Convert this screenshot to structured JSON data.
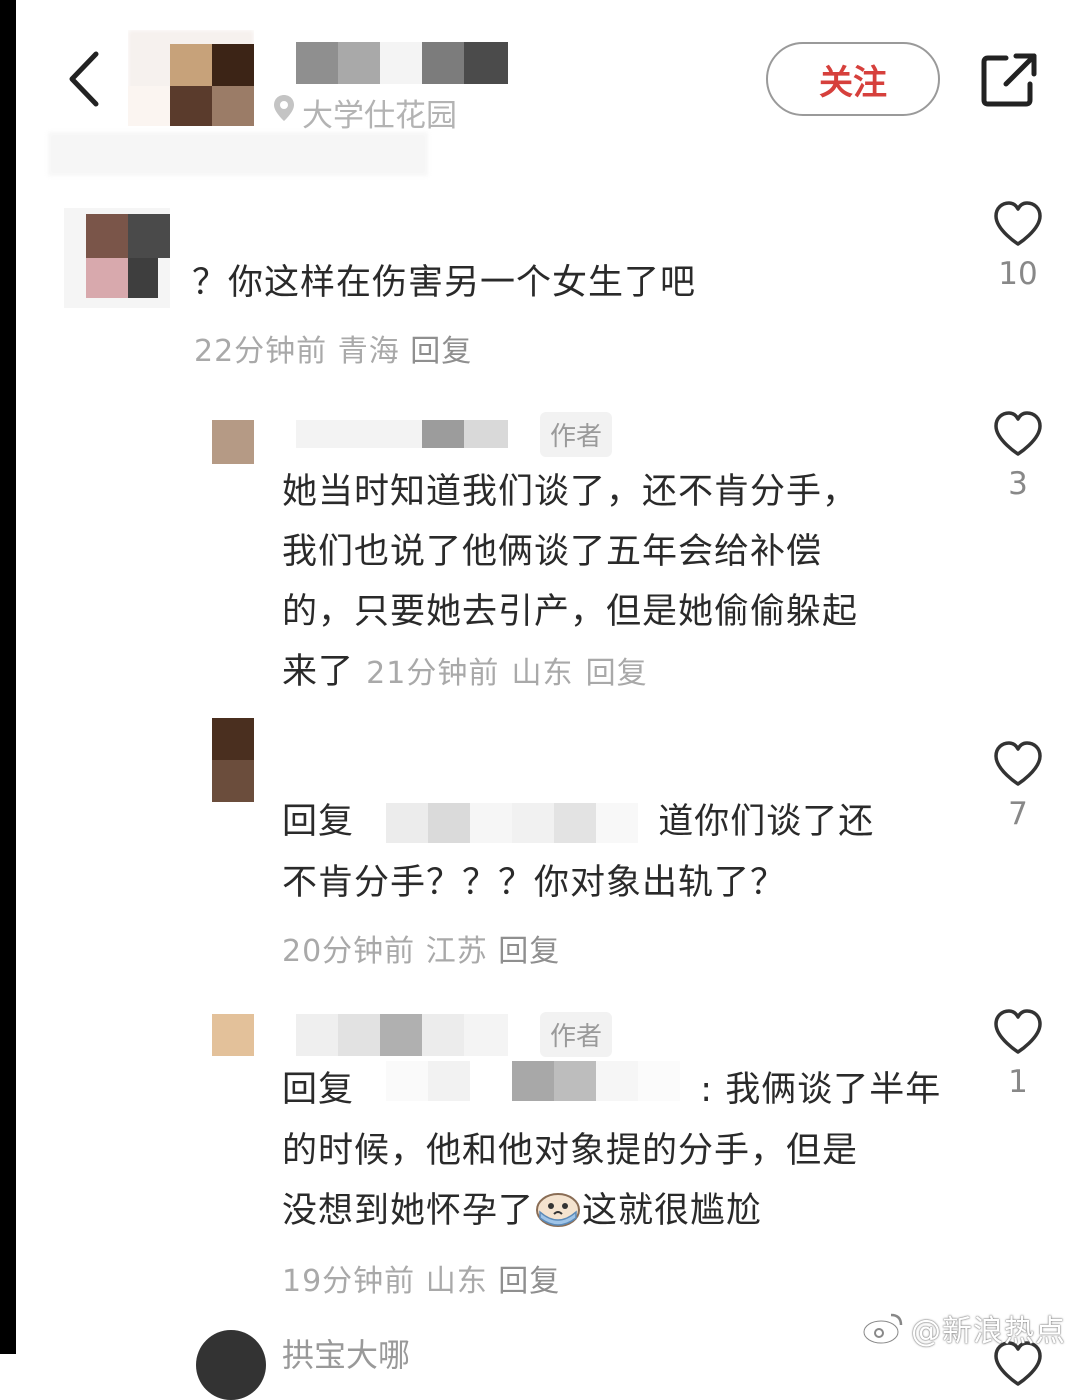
{
  "header": {
    "location": "大学仕花园",
    "follow_label": "关注"
  },
  "comments": [
    {
      "text": "？你这样在伤害另一个女生了吧",
      "time": "22分钟前",
      "region": "青海",
      "reply_label": "回复",
      "likes": "10"
    },
    {
      "author_tag": "作者",
      "lines": [
        "她当时知道我们谈了，还不肯分手，",
        "我们也说了他俩谈了五年会给补偿",
        "的，只要她去引产，但是她偷偷躲起"
      ],
      "last_line": "来了",
      "time": "21分钟前",
      "region": "山东",
      "reply_label": "回复",
      "likes": "3"
    },
    {
      "reply_prefix": "回复",
      "line1_tail": "道你们谈了还",
      "line2": "不肯分手？？？你对象出轨了？",
      "time": "20分钟前",
      "region": "江苏",
      "reply_label": "回复",
      "likes": "7"
    },
    {
      "author_tag": "作者",
      "reply_prefix": "回复",
      "line1_tail": ": 我俩谈了半年",
      "line2": "的时候，他和他对象提的分手，但是",
      "line3_head": "没想到她怀孕了",
      "line3_tail": "这就很尴尬",
      "time": "19分钟前",
      "region": "山东",
      "reply_label": "回复",
      "likes": "1"
    }
  ],
  "footer": {
    "next_name_partial": "拱宝大哪"
  },
  "watermark": "@新浪热点",
  "colors": {
    "follow_text": "#d6403c",
    "meta_text": "#a9a9a9",
    "body_text": "#2a2a2a"
  },
  "icons": [
    "back-arrow-icon",
    "share-icon",
    "location-pin-icon",
    "heart-icon",
    "weibo-logo-icon",
    "crying-emoji-icon"
  ]
}
